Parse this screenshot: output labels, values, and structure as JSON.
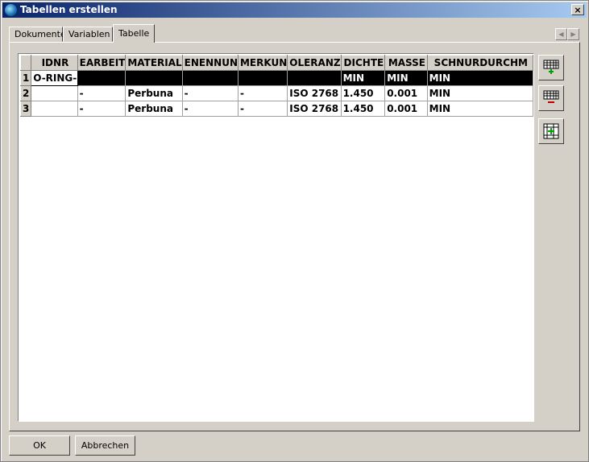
{
  "window": {
    "title": "Tabellen erstellen",
    "close_glyph": "×"
  },
  "tabs": [
    {
      "label": "Dokumente",
      "active": false
    },
    {
      "label": "Variablen",
      "active": false
    },
    {
      "label": "Tabelle",
      "active": true
    }
  ],
  "grid": {
    "columns": [
      "IDNR",
      "BEARBEITER",
      "MATERIAL",
      "BENENNUNG",
      "BEMERKUNG",
      "TOLERANZ",
      "DICHTE",
      "MASSE",
      "SCHNURDURCHM"
    ],
    "column_display": [
      "IDNR",
      "EARBEIT",
      "MATERIAL",
      "ENENNUN",
      "MERKUN",
      "OLERANZ",
      "DICHTE",
      "MASSE",
      "SCHNURDURCHM"
    ],
    "rows": [
      {
        "num": "1",
        "cells": [
          "O-RING-",
          "",
          "",
          "",
          "",
          "",
          "MIN",
          "MIN",
          "MIN"
        ],
        "selected": true
      },
      {
        "num": "2",
        "cells": [
          "",
          "-",
          "Perbuna",
          "-",
          "-",
          "ISO 2768",
          "1.450",
          "0.001",
          "MIN"
        ],
        "selected": false
      },
      {
        "num": "3",
        "cells": [
          "",
          "-",
          "Perbuna",
          "-",
          "-",
          "ISO 2768",
          "1.450",
          "0.001",
          "MIN"
        ],
        "selected": false
      }
    ]
  },
  "buttons": {
    "ok": "OK",
    "cancel": "Abbrechen"
  },
  "side_buttons": [
    "add-row-icon",
    "delete-row-icon",
    "insert-row-icon"
  ],
  "colors": {
    "titlebar_start": "#0a246a",
    "titlebar_end": "#a6caf0",
    "plus_green": "#00a000",
    "minus_red": "#c00000"
  }
}
